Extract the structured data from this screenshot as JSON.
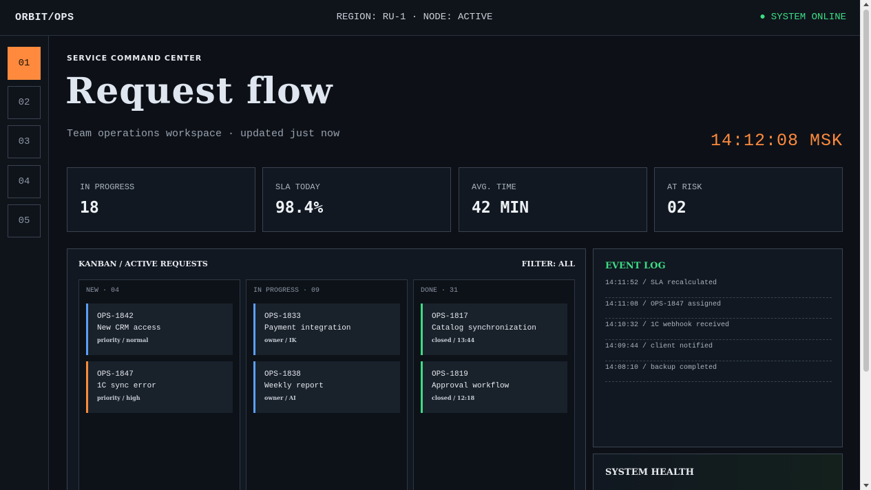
{
  "topbar": {
    "brand": "ORBIT/OPS",
    "region": "REGION: RU-1 · NODE: ACTIVE",
    "status_dot": "●",
    "status": "SYSTEM ONLINE"
  },
  "rail": {
    "items": [
      "01",
      "02",
      "03",
      "04",
      "05"
    ],
    "active": "01"
  },
  "header": {
    "eyebrow": "SERVICE COMMAND CENTER",
    "title": "Request flow",
    "subtitle": "Team operations workspace · updated just now",
    "clock": "14:12:08 MSK"
  },
  "kpis": [
    {
      "label": "IN PROGRESS",
      "value": "18"
    },
    {
      "label": "SLA TODAY",
      "value": "98.4%"
    },
    {
      "label": "AVG. TIME",
      "value": "42 MIN"
    },
    {
      "label": "AT RISK",
      "value": "02"
    }
  ],
  "kanban": {
    "title": "KANBAN / ACTIVE REQUESTS",
    "filter": "FILTER: ALL",
    "columns": [
      {
        "title": "NEW · 04",
        "cards": [
          {
            "id": "OPS-1842",
            "name": "New CRM access",
            "meta": "priority / normal",
            "accent": "blue"
          },
          {
            "id": "OPS-1847",
            "name": "1C sync error",
            "meta": "priority / high",
            "accent": "orange"
          }
        ]
      },
      {
        "title": "IN PROGRESS · 09",
        "cards": [
          {
            "id": "OPS-1833",
            "name": "Payment integration",
            "meta": "owner / IK",
            "accent": "blue"
          },
          {
            "id": "OPS-1838",
            "name": "Weekly report",
            "meta": "owner / AI",
            "accent": "blue"
          }
        ]
      },
      {
        "title": "DONE · 31",
        "cards": [
          {
            "id": "OPS-1817",
            "name": "Catalog synchronization",
            "meta": "closed / 13:44",
            "accent": "green"
          },
          {
            "id": "OPS-1819",
            "name": "Approval workflow",
            "meta": "closed / 12:18",
            "accent": "green"
          }
        ]
      }
    ]
  },
  "event_log": {
    "title": "EVENT LOG",
    "entries": [
      "14:11:52 / SLA recalculated",
      "14:11:08 / OPS-1847 assigned",
      "14:10:32 / 1C webhook received",
      "14:09:44 / client notified",
      "14:08:10 / backup completed"
    ]
  },
  "system_health": {
    "title": "SYSTEM HEALTH"
  },
  "colors": {
    "accent": "#ff8a3d",
    "online": "#3ddc84",
    "blue": "#5aa0ff",
    "background": "#0d1117"
  }
}
